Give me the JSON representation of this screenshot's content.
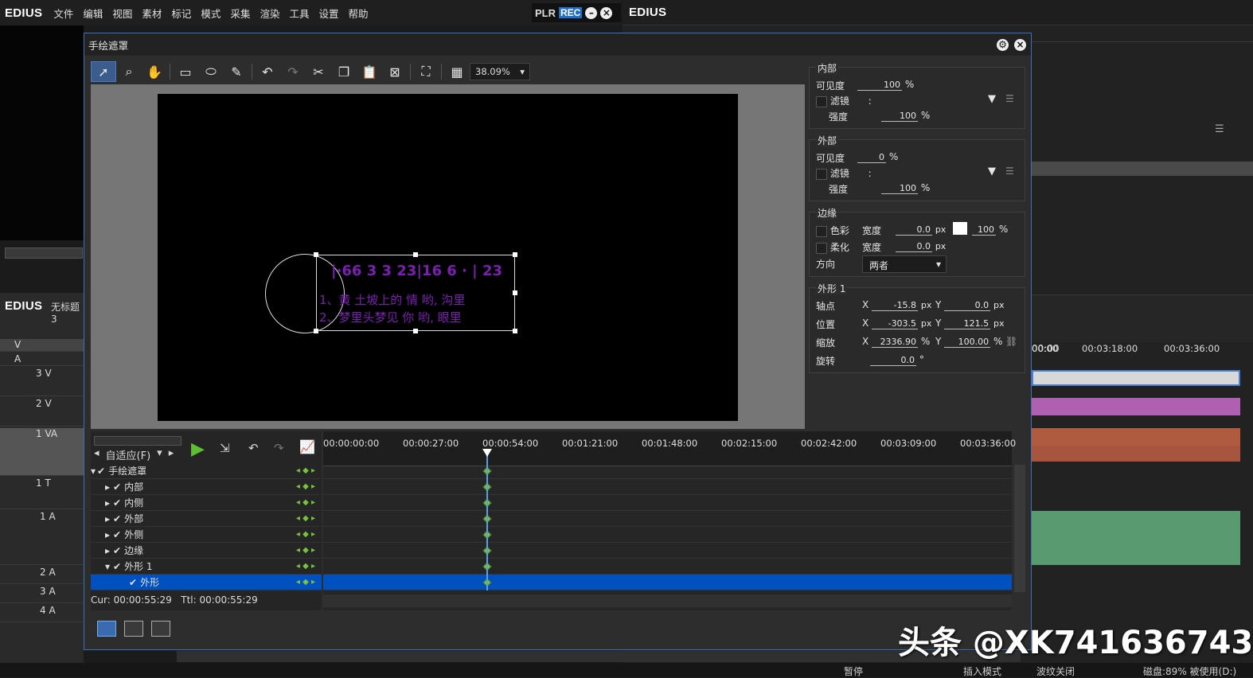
{
  "app": {
    "logo": "EDIUS"
  },
  "menu": [
    "文件",
    "编辑",
    "视图",
    "素材",
    "标记",
    "模式",
    "采集",
    "渲染",
    "工具",
    "设置",
    "帮助"
  ],
  "player": {
    "plr": "PLR",
    "rec": "REC"
  },
  "right_panel": {
    "logo": "EDIUS"
  },
  "left_panel": {
    "logo": "EDIUS",
    "project": "无标题3",
    "tracks": [
      "V",
      "A",
      "3 V",
      "2 V",
      "1 VA",
      "1 T",
      "1 A",
      "2 A",
      "3 A",
      "4 A"
    ]
  },
  "dialog": {
    "title": "手绘遮罩",
    "zoom": "38.09%",
    "canvas_text": {
      "notes": "|·66 3 3 23|16 6 · | 23",
      "line1": "1、黄 土坡上的 情 哟, 沟里",
      "line2": "2、梦里头梦见 你 哟, 眼里"
    },
    "props": {
      "inner": {
        "label": "内部",
        "visibility_label": "可见度",
        "visibility": "100",
        "unit": "%",
        "filter_label": "滤镜",
        "filter_value": ":",
        "strength_label": "强度",
        "strength": "100"
      },
      "outer": {
        "label": "外部",
        "visibility_label": "可见度",
        "visibility": "0",
        "unit": "%",
        "filter_label": "滤镜",
        "filter_value": ":",
        "strength_label": "强度",
        "strength": "100"
      },
      "edge": {
        "label": "边缘",
        "color_label": "色彩",
        "width_label": "宽度",
        "color_width": "0.0",
        "px": "px",
        "color_pct": "100",
        "soft_label": "柔化",
        "soft_width": "0.0",
        "direction_label": "方向",
        "direction": "两者"
      },
      "shape": {
        "label": "外形 1",
        "anchor_label": "轴点",
        "anchor_x": "-15.8",
        "anchor_y": "0.0",
        "pos_label": "位置",
        "pos_x": "-303.5",
        "pos_y": "121.5",
        "scale_label": "缩放",
        "scale_x": "2336.90",
        "scale_y": "100.00",
        "rot_label": "旋转",
        "rot": "0.0",
        "deg": "°",
        "x": "X",
        "y": "Y",
        "px": "px",
        "pct": "%"
      }
    },
    "timeline": {
      "fit": "自适应(F)",
      "ticks": [
        "00:00:00:00",
        "00:00:27:00",
        "00:00:54:00",
        "00:01:21:00",
        "00:01:48:00",
        "00:02:15:00",
        "00:02:42:00",
        "00:03:09:00",
        "00:03:36:00"
      ],
      "rows": [
        {
          "label": "手绘遮罩",
          "indent": 0,
          "expand": "▾"
        },
        {
          "label": "内部",
          "indent": 1,
          "expand": "▸"
        },
        {
          "label": "内侧",
          "indent": 1,
          "expand": "▸"
        },
        {
          "label": "外部",
          "indent": 1,
          "expand": "▸"
        },
        {
          "label": "外侧",
          "indent": 1,
          "expand": "▸"
        },
        {
          "label": "边缘",
          "indent": 1,
          "expand": "▸"
        },
        {
          "label": "外形 1",
          "indent": 1,
          "expand": "▾"
        },
        {
          "label": "外形",
          "indent": 2,
          "expand": ""
        }
      ],
      "cur_label": "Cur:",
      "cur": "00:00:55:29",
      "ttl_label": "Ttl:",
      "ttl": "00:00:55:29"
    }
  },
  "main_timeline": {
    "ticks": [
      "00:00",
      "00:03:18:00",
      "00:03:36:00"
    ]
  },
  "status": {
    "a": "暂停",
    "b": "插入模式",
    "c": "波纹关闭",
    "d": "磁盘:89% 被使用(D:)"
  },
  "watermark": "头条 @XK741636743",
  "colors": {
    "accent": "#3a6ab0",
    "keyframe": "#7ac043",
    "selection": "#0050c0",
    "purple_text": "#7a1fb0"
  }
}
